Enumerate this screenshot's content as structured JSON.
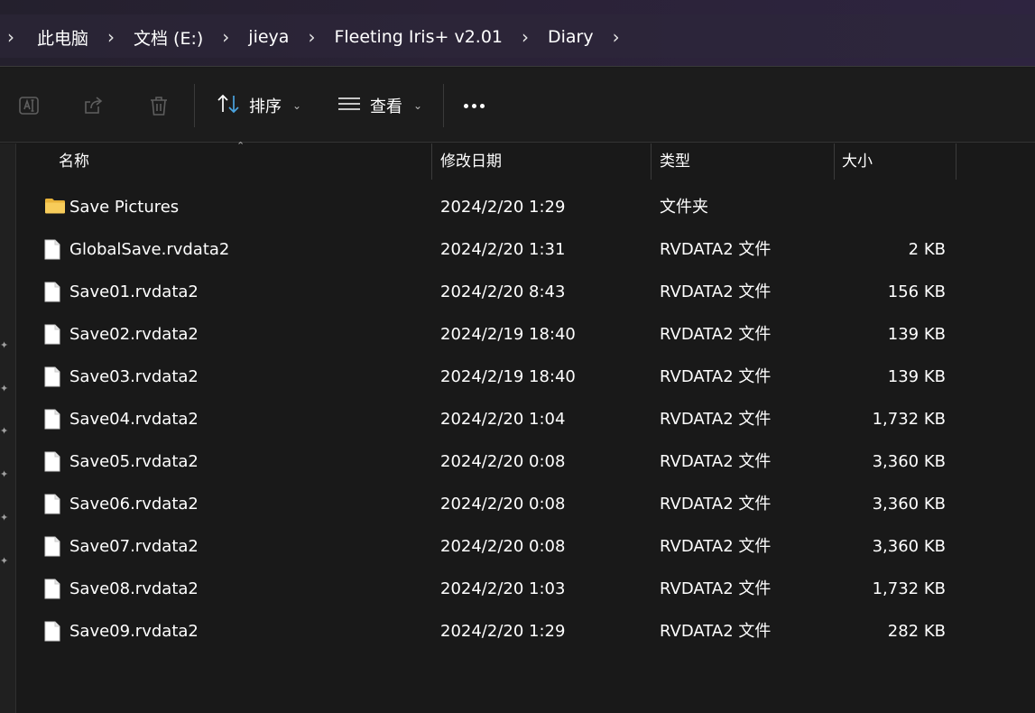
{
  "breadcrumb": {
    "items": [
      "此电脑",
      "文档 (E:)",
      "jieya",
      "Fleeting Iris+ v2.01",
      "Diary"
    ],
    "separator": "›"
  },
  "toolbar": {
    "icons": [
      "rename-icon",
      "share-icon",
      "delete-icon"
    ],
    "sort_label": "排序",
    "view_label": "查看",
    "more_icon": "more-icon"
  },
  "columns": {
    "name": "名称",
    "date": "修改日期",
    "type": "类型",
    "size": "大小",
    "sort_column": "name",
    "sort_direction": "ascending"
  },
  "files": [
    {
      "icon": "folder-icon",
      "name": "Save Pictures",
      "date": "2024/2/20 1:29",
      "type": "文件夹",
      "size": ""
    },
    {
      "icon": "file-icon",
      "name": "GlobalSave.rvdata2",
      "date": "2024/2/20 1:31",
      "type": "RVDATA2 文件",
      "size": "2 KB"
    },
    {
      "icon": "file-icon",
      "name": "Save01.rvdata2",
      "date": "2024/2/20 8:43",
      "type": "RVDATA2 文件",
      "size": "156 KB"
    },
    {
      "icon": "file-icon",
      "name": "Save02.rvdata2",
      "date": "2024/2/19 18:40",
      "type": "RVDATA2 文件",
      "size": "139 KB"
    },
    {
      "icon": "file-icon",
      "name": "Save03.rvdata2",
      "date": "2024/2/19 18:40",
      "type": "RVDATA2 文件",
      "size": "139 KB"
    },
    {
      "icon": "file-icon",
      "name": "Save04.rvdata2",
      "date": "2024/2/20 1:04",
      "type": "RVDATA2 文件",
      "size": "1,732 KB"
    },
    {
      "icon": "file-icon",
      "name": "Save05.rvdata2",
      "date": "2024/2/20 0:08",
      "type": "RVDATA2 文件",
      "size": "3,360 KB"
    },
    {
      "icon": "file-icon",
      "name": "Save06.rvdata2",
      "date": "2024/2/20 0:08",
      "type": "RVDATA2 文件",
      "size": "3,360 KB"
    },
    {
      "icon": "file-icon",
      "name": "Save07.rvdata2",
      "date": "2024/2/20 0:08",
      "type": "RVDATA2 文件",
      "size": "3,360 KB"
    },
    {
      "icon": "file-icon",
      "name": "Save08.rvdata2",
      "date": "2024/2/20 1:03",
      "type": "RVDATA2 文件",
      "size": "1,732 KB"
    },
    {
      "icon": "file-icon",
      "name": "Save09.rvdata2",
      "date": "2024/2/20 1:29",
      "type": "RVDATA2 文件",
      "size": "282 KB"
    }
  ],
  "colors": {
    "background": "#191919",
    "folder": "#f2c14e",
    "text": "#ffffff",
    "icon_disabled": "#5e5e5e",
    "accent": "#4aa3df"
  }
}
